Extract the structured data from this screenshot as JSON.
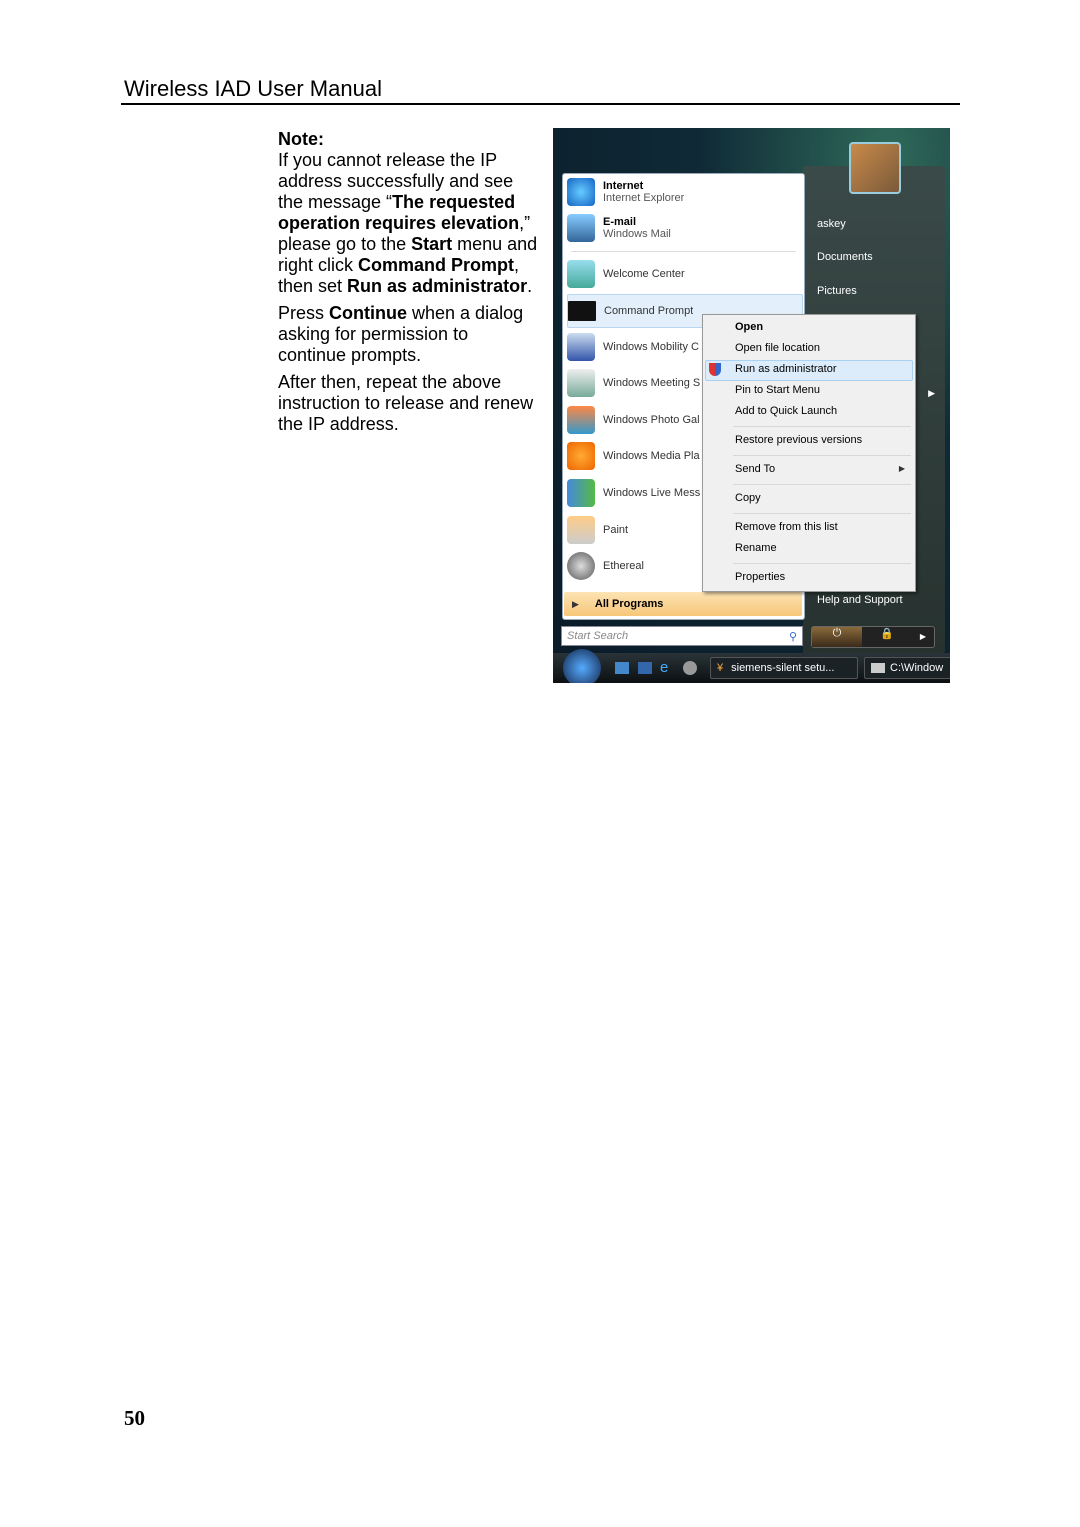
{
  "header": {
    "title": "Wireless IAD User Manual"
  },
  "note": {
    "heading": "Note:",
    "p1": [
      "If you cannot release the IP address successfully and see the message “",
      "The requested operation requires elevation",
      ",” please go to the ",
      "Start",
      " menu and right click ",
      "Command Prompt",
      ", then set ",
      "Run as administrator",
      "."
    ],
    "p2": [
      "Press ",
      "Continue",
      " when a dialog asking for permission to continue prompts."
    ],
    "p3": "After then, repeat the above instruction to release and renew the IP address."
  },
  "page_number": "50",
  "start_menu": {
    "pinned": [
      {
        "title": "Internet",
        "sub": "Internet Explorer",
        "icon": "internet-explorer-icon"
      },
      {
        "title": "E-mail",
        "sub": "Windows Mail",
        "icon": "mail-icon"
      }
    ],
    "recent": [
      {
        "label": "Welcome Center",
        "icon": "welcome-center-icon"
      },
      {
        "label": "Command Prompt",
        "icon": "command-prompt-icon"
      },
      {
        "label": "Windows Mobility C",
        "icon": "mobility-center-icon"
      },
      {
        "label": "Windows Meeting S",
        "icon": "meeting-space-icon"
      },
      {
        "label": "Windows Photo Gal",
        "icon": "photo-gallery-icon"
      },
      {
        "label": "Windows Media Pla",
        "icon": "media-player-icon"
      },
      {
        "label": "Windows Live Mess",
        "icon": "live-messenger-icon"
      },
      {
        "label": "Paint",
        "icon": "paint-icon"
      },
      {
        "label": "Ethereal",
        "icon": "ethereal-icon"
      }
    ],
    "all_programs": "All Programs",
    "search_placeholder": "Start Search",
    "right": [
      "askey",
      "Documents",
      "Pictures"
    ],
    "help": "Help and Support",
    "context_menu": [
      "Open",
      "Open file location",
      "Run as administrator",
      "Pin to Start Menu",
      "Add to Quick Launch",
      "Restore previous versions",
      "Send To",
      "Copy",
      "Remove from this list",
      "Rename",
      "Properties"
    ],
    "taskbar": [
      "siemens-silent setu...",
      "C:\\Window"
    ]
  }
}
